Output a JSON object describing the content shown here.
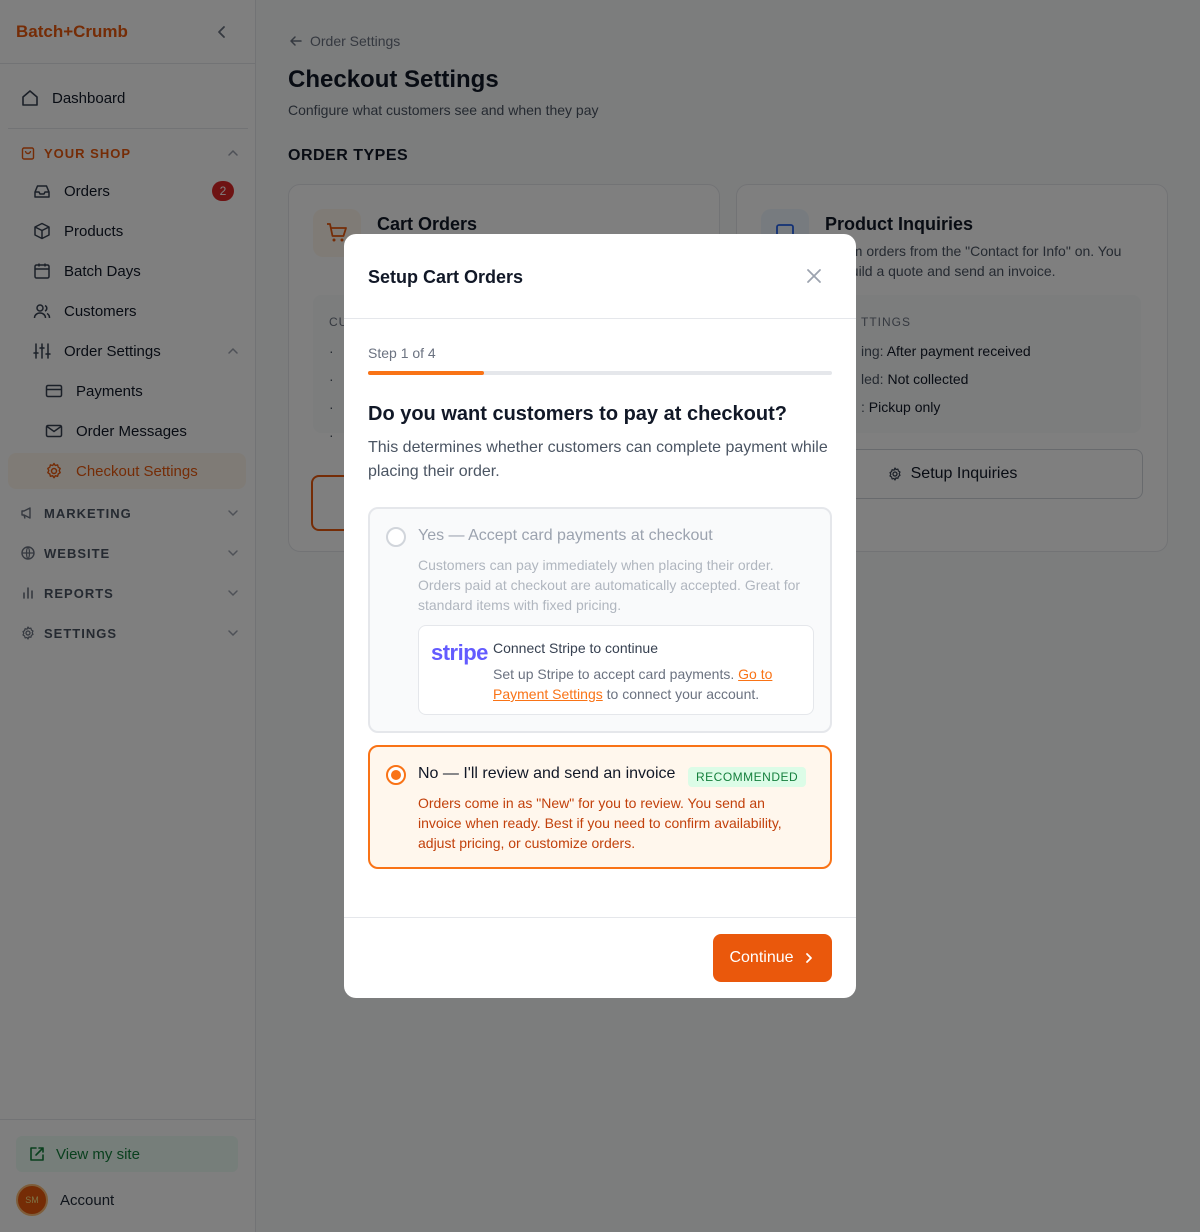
{
  "brand": "Batch+Crumb",
  "sidebar": {
    "dashboard": "Dashboard",
    "your_shop": "YOUR SHOP",
    "orders": "Orders",
    "orders_badge": "2",
    "products": "Products",
    "batch_days": "Batch Days",
    "customers": "Customers",
    "order_settings": "Order Settings",
    "payments": "Payments",
    "order_messages": "Order Messages",
    "checkout_settings": "Checkout Settings",
    "marketing": "MARKETING",
    "website": "WEBSITE",
    "reports": "REPORTS",
    "settings": "SETTINGS",
    "view_site": "View my site",
    "avatar_initials": "SM",
    "account": "Account"
  },
  "page": {
    "breadcrumb": "Order Settings",
    "title": "Checkout Settings",
    "subtitle": "Configure what customers see and when they pay",
    "section": "ORDER TYPES"
  },
  "cards": {
    "cart": {
      "title": "Cart Orders",
      "box_header": "CU",
      "bullets": [
        "·",
        "·",
        "·",
        "·"
      ]
    },
    "inquiries": {
      "title": "Product Inquiries",
      "desc": "om orders from the \"Contact for Info\" on. You build a quote and send an invoice.",
      "box_header": "TTINGS",
      "rows": [
        {
          "label": "ing:",
          "value": "After payment received"
        },
        {
          "label": "led:",
          "value": "Not collected"
        },
        {
          "label": ":",
          "value": "Pickup only"
        }
      ],
      "button": "Setup Inquiries"
    }
  },
  "modal": {
    "title": "Setup Cart Orders",
    "step": "Step 1 of 4",
    "progress": 0.25,
    "question": "Do you want customers to pay at checkout?",
    "question_desc": "This determines whether customers can complete payment while placing their order.",
    "option_yes": {
      "title": "Yes — Accept card payments at checkout",
      "desc": "Customers can pay immediately when placing their order. Orders paid at checkout are automatically accepted. Great for standard items with fixed pricing.",
      "selected": false,
      "disabled": true
    },
    "stripe": {
      "logo": "stripe",
      "title": "Connect Stripe to continue",
      "desc_before": "Set up Stripe to accept card payments. ",
      "link": "Go to Payment Settings",
      "desc_after": " to connect your account."
    },
    "option_no": {
      "title": "No — I'll review and send an invoice",
      "badge": "RECOMMENDED",
      "desc": "Orders come in as \"New\" for you to review. You send an invoice when ready. Best if you need to confirm availability, adjust pricing, or customize orders.",
      "selected": true
    },
    "continue": "Continue"
  },
  "colors": {
    "accent": "#ea580c",
    "accent_light": "#fff7ed",
    "badge_red": "#dc2626",
    "recommended_bg": "#dcfce7",
    "recommended_text": "#15803d",
    "stripe": "#635bff"
  }
}
